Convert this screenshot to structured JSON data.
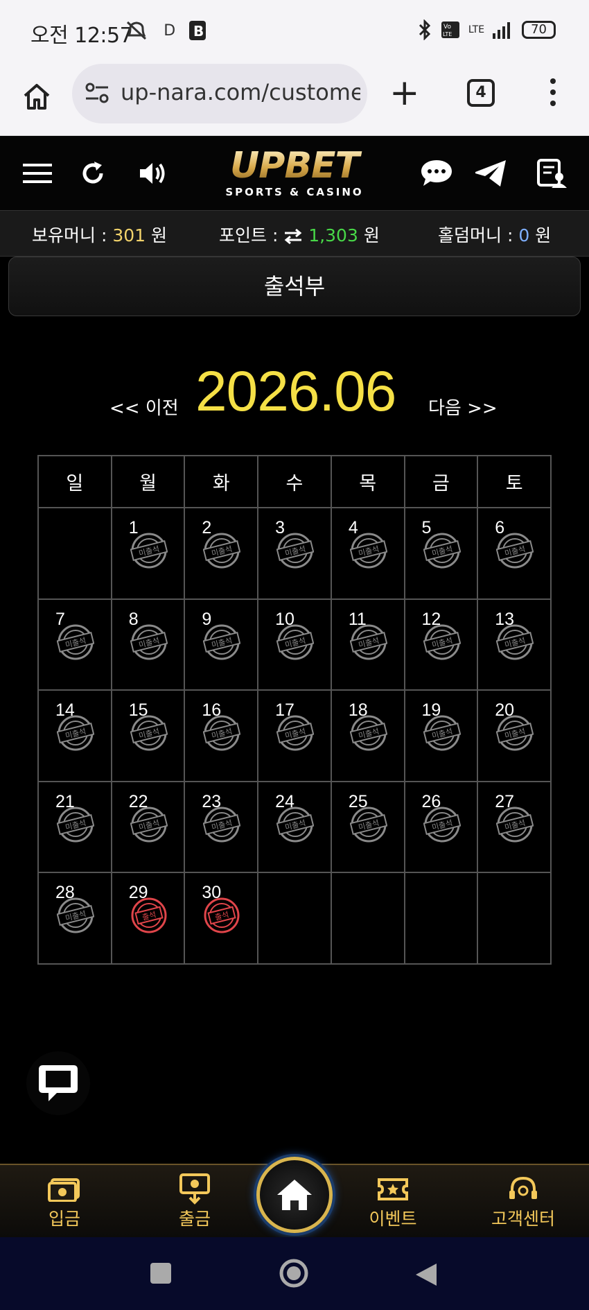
{
  "status_bar": {
    "time": "오전 12:57",
    "extra_indicators": "D",
    "network": "LTE",
    "battery": "70"
  },
  "browser": {
    "url": "up-nara.com/custome",
    "tab_count": "4"
  },
  "header": {
    "logo_main": "UPBET",
    "logo_sub": "SPORTS & CASINO"
  },
  "balance": {
    "money_label": "보유머니 :",
    "money_value": "301",
    "money_unit": "원",
    "point_label": "포인트 :",
    "point_value": "1,303",
    "point_unit": "원",
    "holdem_label": "홀덤머니 :",
    "holdem_value": "0",
    "holdem_unit": "원"
  },
  "page_title": "출석부",
  "calendar": {
    "prev_label": "<< 이전",
    "next_label": "다음 >>",
    "month": "2026.06",
    "weekdays": [
      "일",
      "월",
      "화",
      "수",
      "목",
      "금",
      "토"
    ],
    "stamp_absent": "미출석",
    "stamp_present": "출석",
    "weeks": [
      [
        null,
        {
          "d": "1",
          "s": "absent"
        },
        {
          "d": "2",
          "s": "absent"
        },
        {
          "d": "3",
          "s": "absent"
        },
        {
          "d": "4",
          "s": "absent"
        },
        {
          "d": "5",
          "s": "absent"
        },
        {
          "d": "6",
          "s": "absent"
        }
      ],
      [
        {
          "d": "7",
          "s": "absent"
        },
        {
          "d": "8",
          "s": "absent"
        },
        {
          "d": "9",
          "s": "absent"
        },
        {
          "d": "10",
          "s": "absent"
        },
        {
          "d": "11",
          "s": "absent"
        },
        {
          "d": "12",
          "s": "absent"
        },
        {
          "d": "13",
          "s": "absent"
        }
      ],
      [
        {
          "d": "14",
          "s": "absent"
        },
        {
          "d": "15",
          "s": "absent"
        },
        {
          "d": "16",
          "s": "absent"
        },
        {
          "d": "17",
          "s": "absent"
        },
        {
          "d": "18",
          "s": "absent"
        },
        {
          "d": "19",
          "s": "absent"
        },
        {
          "d": "20",
          "s": "absent"
        }
      ],
      [
        {
          "d": "21",
          "s": "absent"
        },
        {
          "d": "22",
          "s": "absent"
        },
        {
          "d": "23",
          "s": "absent"
        },
        {
          "d": "24",
          "s": "absent"
        },
        {
          "d": "25",
          "s": "absent"
        },
        {
          "d": "26",
          "s": "absent"
        },
        {
          "d": "27",
          "s": "absent"
        }
      ],
      [
        {
          "d": "28",
          "s": "absent"
        },
        {
          "d": "29",
          "s": "present"
        },
        {
          "d": "30",
          "s": "present"
        },
        null,
        null,
        null,
        null
      ]
    ]
  },
  "bottom_nav": {
    "deposit": "입금",
    "withdraw": "출금",
    "event": "이벤트",
    "support": "고객센터"
  },
  "colors": {
    "accent_gold": "#f3c85a",
    "month_yellow": "#f5e046",
    "point_green": "#48d848",
    "stamp_red": "#e0454a",
    "stamp_gray": "#8a8a8a"
  }
}
